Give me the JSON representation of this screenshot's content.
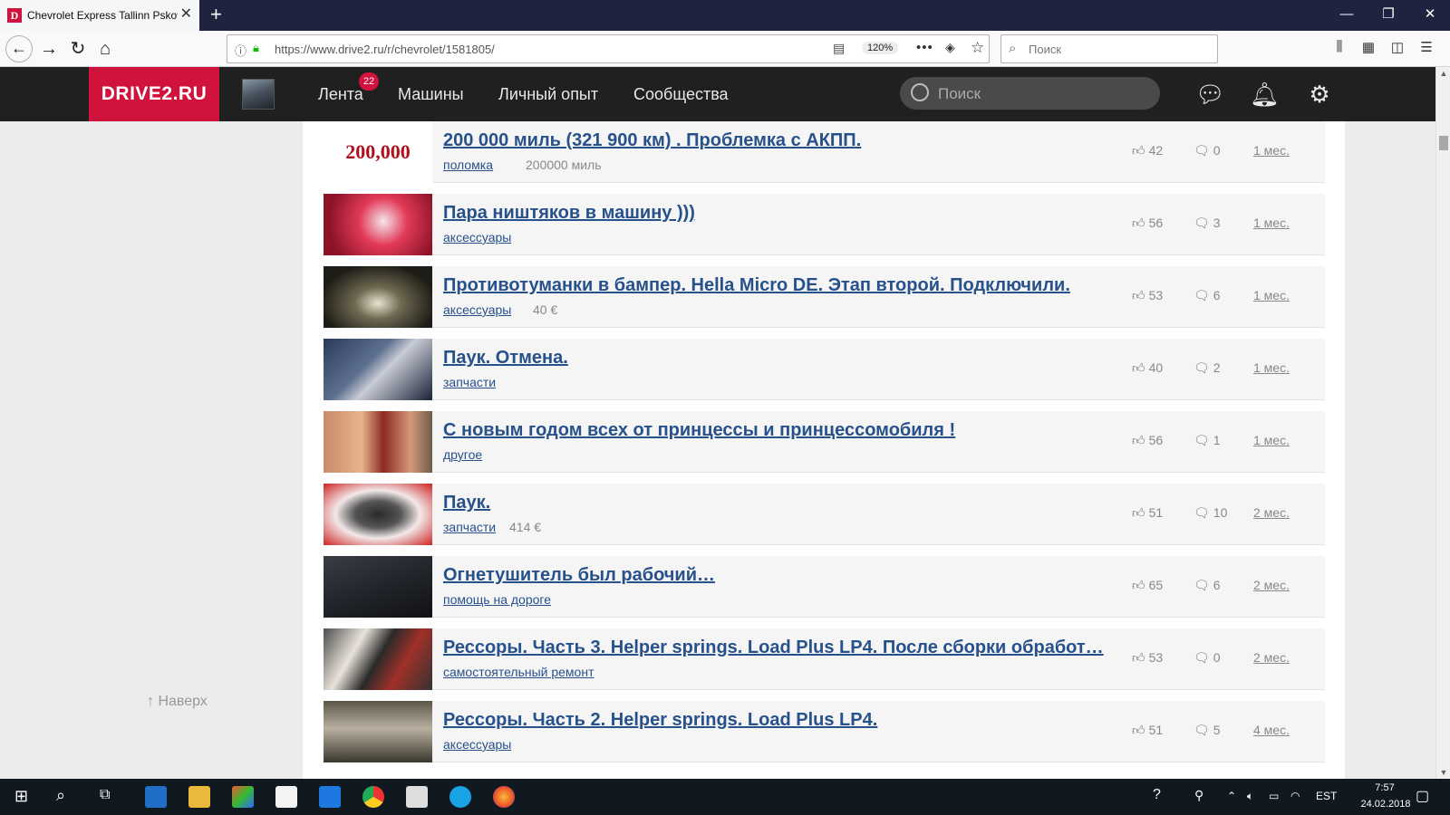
{
  "browser": {
    "tab_title": "Chevrolet Express Tallinn Pskov",
    "favicon_letter": "D",
    "new_tab": "+",
    "url": "https://www.drive2.ru/r/chevrolet/1581805/",
    "zoom": "120%",
    "search_placeholder": "Поиск",
    "minimize": "—",
    "restore": "❐",
    "close": "✕"
  },
  "site": {
    "logo": "DRIVE2.RU",
    "nav": [
      "Лента",
      "Машины",
      "Личный опыт",
      "Сообщества"
    ],
    "feed_badge": "22",
    "search_placeholder": "Поиск"
  },
  "posts": [
    {
      "title": "200 000 миль (321 900 км) . Проблемка с АКПП.",
      "tag": "поломка",
      "extra": "200000 миль",
      "likes": "42",
      "comments": "0",
      "date": "1 мес.",
      "thumb_text": "200,000"
    },
    {
      "title": "Пара ништяков в машину )))",
      "tag": "аксессуары",
      "extra": "",
      "likes": "56",
      "comments": "3",
      "date": "1 мес."
    },
    {
      "title": "Противотуманки в бампер. Hella Micro DE. Этап второй. Подключили.",
      "tag": "аксессуары",
      "extra": "40 €",
      "likes": "53",
      "comments": "6",
      "date": "1 мес."
    },
    {
      "title": "Паук. Отмена.",
      "tag": "запчасти",
      "extra": "",
      "likes": "40",
      "comments": "2",
      "date": "1 мес."
    },
    {
      "title": "С новым годом всех от принцессы и принцессомобиля !",
      "tag": "другое",
      "extra": "",
      "likes": "56",
      "comments": "1",
      "date": "1 мес."
    },
    {
      "title": "Паук.",
      "tag": "запчасти",
      "extra": "414 €",
      "likes": "51",
      "comments": "10",
      "date": "2 мес."
    },
    {
      "title": "Огнетушитель был рабочий…",
      "tag": "помощь на дороге",
      "extra": "",
      "likes": "65",
      "comments": "6",
      "date": "2 мес."
    },
    {
      "title": "Рессоры. Часть 3. Helper springs. Load Plus LP4. После сборки обработ…",
      "tag": "самостоятельный ремонт",
      "extra": "",
      "likes": "53",
      "comments": "0",
      "date": "2 мес."
    },
    {
      "title": "Рессоры. Часть 2. Helper springs. Load Plus LP4.",
      "tag": "аксессуары",
      "extra": "",
      "likes": "51",
      "comments": "5",
      "date": "4 мес."
    }
  ],
  "to_top": "↑ Наверх",
  "taskbar": {
    "time": "7:57",
    "date": "24.02.2018",
    "lang": "EST"
  }
}
